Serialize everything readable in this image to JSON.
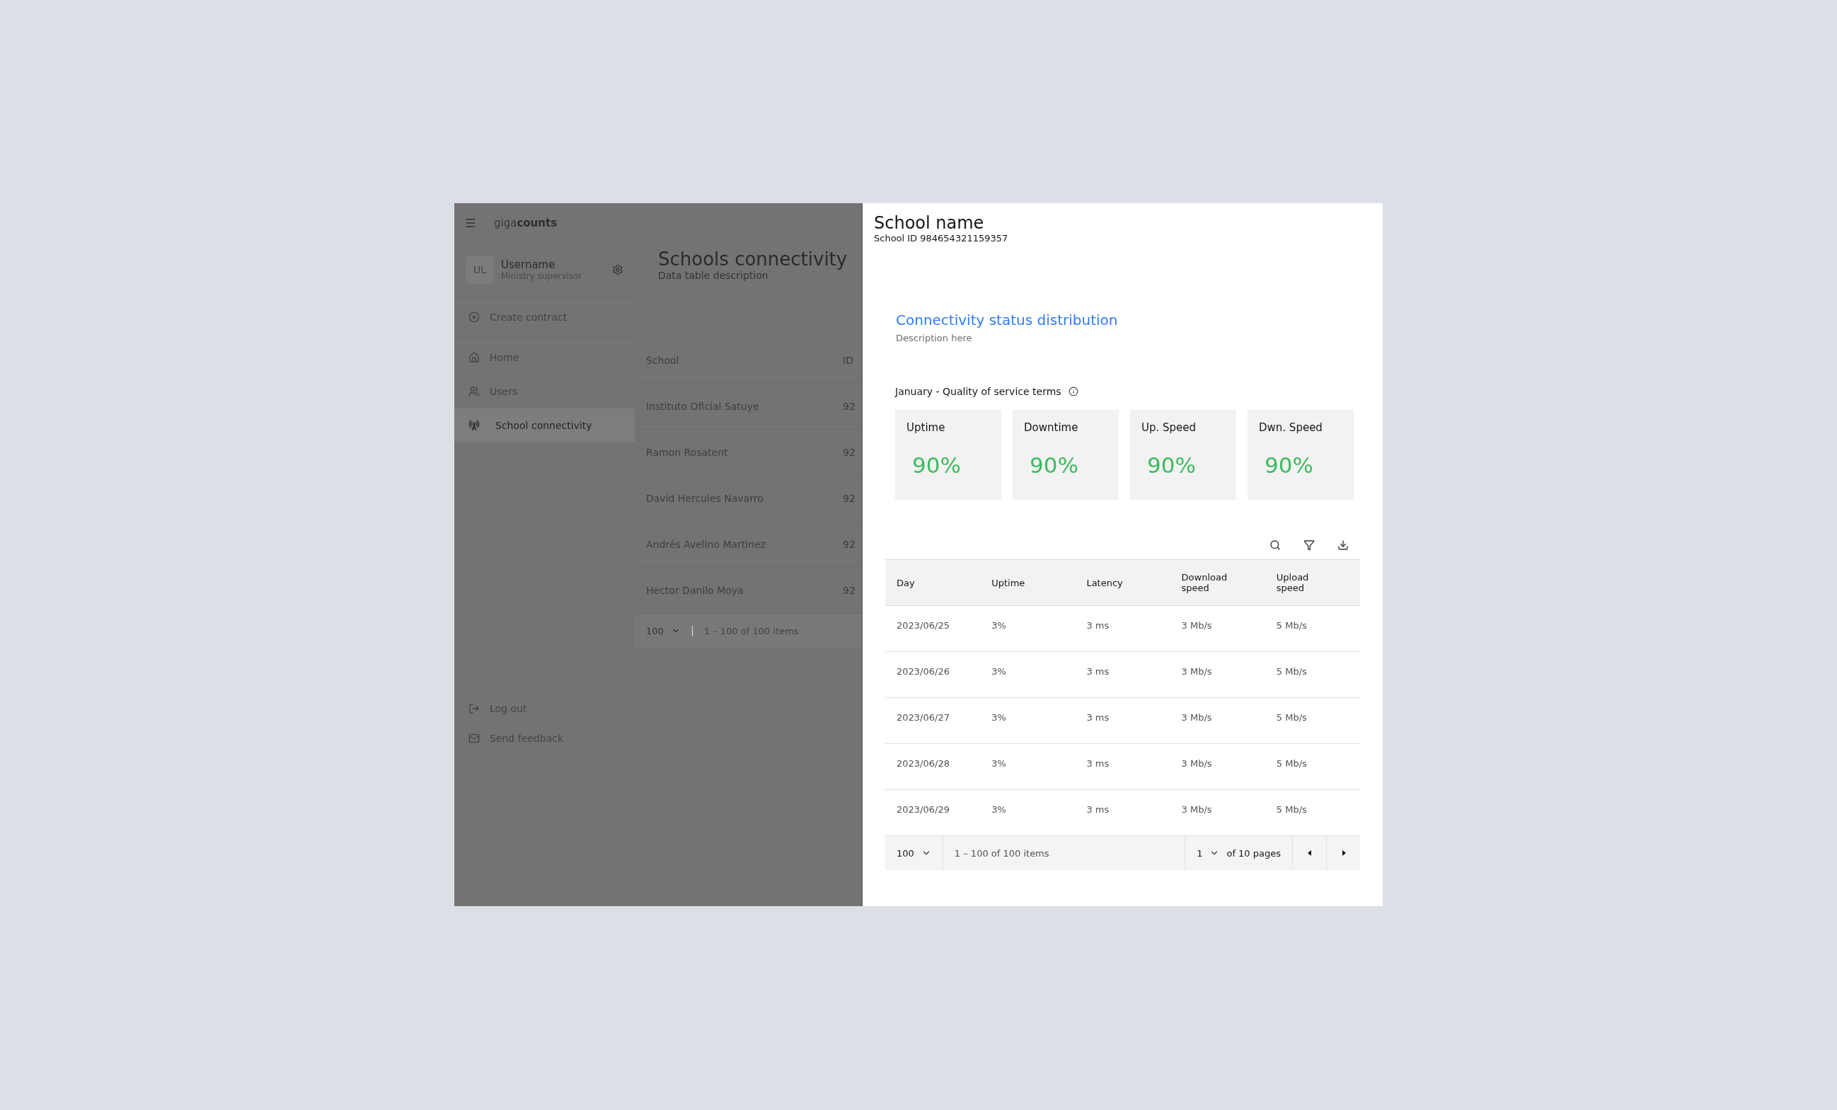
{
  "app": {
    "logo": {
      "light": "giga",
      "bold": "counts"
    },
    "user": {
      "initials": "UL",
      "name": "Username",
      "role": "Ministry supervisor"
    },
    "create_action": "Create contract",
    "nav": [
      {
        "label": "Home",
        "selected": false
      },
      {
        "label": "Users",
        "selected": false
      },
      {
        "label": "School connectivity",
        "selected": true
      }
    ],
    "bottom_nav": [
      {
        "label": "Log out"
      },
      {
        "label": "Send feedback"
      }
    ],
    "page": {
      "title": "Schools connectivity",
      "description": "Data table description",
      "columns": [
        "School",
        "ID"
      ],
      "rows": [
        [
          "Instituto Oficial Satuye",
          "92"
        ],
        [
          "Ramon Rosatent",
          "92"
        ],
        [
          "David Hercules Navarro",
          "92"
        ],
        [
          "Andrés Avelino Martinez",
          "92"
        ],
        [
          "Hector Danilo Moya",
          "92"
        ]
      ],
      "pagination": {
        "page_size": "100",
        "range": "1 – 100 of 100 items"
      }
    }
  },
  "detail_panel": {
    "title": "School name",
    "subtitle": "School ID 984654321159357",
    "section_title": "Connectivity status distribution",
    "section_description": "Description here",
    "metrics_title": "January - Quality of service terms",
    "metrics": [
      {
        "label": "Uptime",
        "value": "90%"
      },
      {
        "label": "Downtime",
        "value": "90%"
      },
      {
        "label": "Up. Speed",
        "value": "90%"
      },
      {
        "label": "Dwn. Speed",
        "value": "90%"
      }
    ],
    "table": {
      "columns": [
        "Day",
        "Uptime",
        "Latency",
        "Download speed",
        "Upload speed"
      ],
      "rows": [
        [
          "2023/06/25",
          "3%",
          "3 ms",
          "3 Mb/s",
          "5 Mb/s"
        ],
        [
          "2023/06/26",
          "3%",
          "3 ms",
          "3 Mb/s",
          "5 Mb/s"
        ],
        [
          "2023/06/27",
          "3%",
          "3 ms",
          "3 Mb/s",
          "5 Mb/s"
        ],
        [
          "2023/06/28",
          "3%",
          "3 ms",
          "3 Mb/s",
          "5 Mb/s"
        ],
        [
          "2023/06/29",
          "3%",
          "3 ms",
          "3 Mb/s",
          "5 Mb/s"
        ]
      ],
      "pagination": {
        "page_size": "100",
        "range": "1 – 100 of 100 items",
        "page": "1",
        "pages": "of 10 pages"
      }
    }
  }
}
